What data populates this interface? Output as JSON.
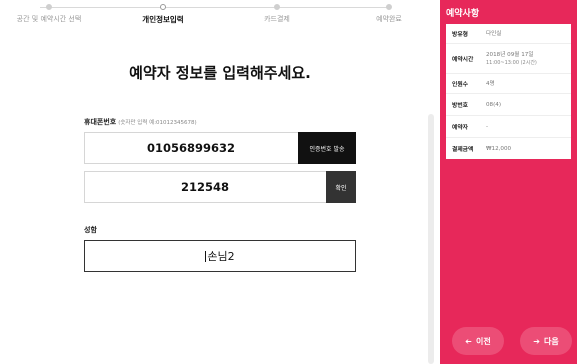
{
  "steps": [
    {
      "label": "공간 및 예약시간 선택"
    },
    {
      "label": "개인정보입력"
    },
    {
      "label": "카드결제"
    },
    {
      "label": "예약완료"
    }
  ],
  "title": "예약자 정보를 입력해주세요.",
  "phone": {
    "label": "휴대폰번호",
    "hint": "(숫자만 입력 예:01012345678)",
    "value": "01056899632",
    "send_button": "인증번호 발송"
  },
  "code": {
    "value": "212548",
    "confirm_button": "확인"
  },
  "name": {
    "label": "성함",
    "value": "손님2"
  },
  "sidebar": {
    "title": "예약사항",
    "rows": [
      {
        "key": "방유형",
        "value": "다인실"
      },
      {
        "key": "예약시간",
        "value": "2018년 09월 17일",
        "value2": "11:00~13:00 (2시간)"
      },
      {
        "key": "인원수",
        "value": "4명"
      },
      {
        "key": "방번호",
        "value": "08(4)"
      },
      {
        "key": "예약자",
        "value": "-"
      },
      {
        "key": "결제금액",
        "value": "₩12,000"
      }
    ],
    "prev_label": "이전",
    "next_label": "다음"
  },
  "colors": {
    "accent": "#e7285a",
    "button_dark": "#111111"
  },
  "icons": {
    "prev": "arrow-left-icon",
    "next": "arrow-right-icon"
  }
}
